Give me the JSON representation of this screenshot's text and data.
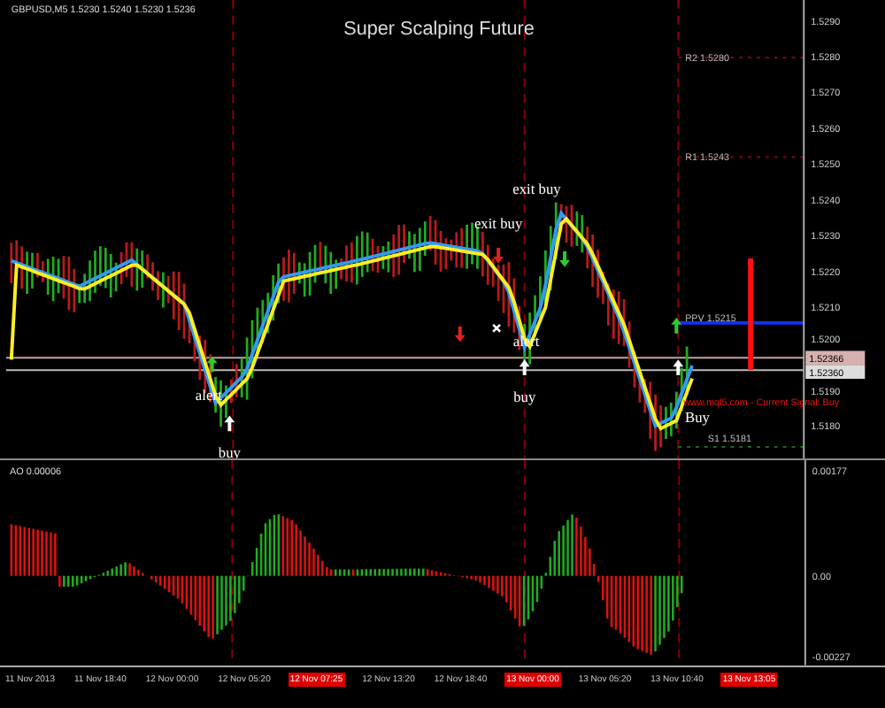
{
  "chart": {
    "symbol_info": "GBPUSD,M5 1.5230 1.5240 1.5230 1.5236",
    "title": "Super Scalping Future",
    "signals": [
      {
        "kind": "label",
        "text": "exit buy"
      },
      {
        "kind": "label",
        "text": "exit buy"
      },
      {
        "kind": "label",
        "text": "alert"
      },
      {
        "kind": "label",
        "text": "alert"
      },
      {
        "kind": "label",
        "text": "buy"
      },
      {
        "kind": "label",
        "text": "Buy"
      },
      {
        "kind": "label",
        "text": "buy"
      }
    ],
    "pivots": [
      {
        "label": "R2 1.5280",
        "kind": "dotted"
      },
      {
        "label": "R1 1.5243",
        "kind": "dotted"
      },
      {
        "label": "PPV 1.5215",
        "kind": "solid"
      },
      {
        "label": "S1 1.5181",
        "kind": "dotted"
      }
    ],
    "current_signal": "www.mql5.com - Current Signal: Buy",
    "price_axis": [
      "1.5290",
      "1.5280",
      "1.5270",
      "1.5260",
      "1.5250",
      "1.5240",
      "1.5230",
      "1.5220",
      "1.5210",
      "1.5200",
      "1.5190",
      "1.5180"
    ],
    "bid_price": "1.52366",
    "ask_price": "1.52360"
  },
  "indicator": {
    "label": "AO 0.00006",
    "axis": [
      "0.00177",
      "0.00",
      "-0.00227"
    ]
  },
  "time_axis": [
    {
      "text": "11 Nov 2013",
      "selected": false
    },
    {
      "text": "11 Nov 18:40",
      "selected": false
    },
    {
      "text": "12 Nov 00:00",
      "selected": false
    },
    {
      "text": "12 Nov 05:20",
      "selected": false
    },
    {
      "text": "12 Nov 07:25",
      "selected": true
    },
    {
      "text": "12 Nov 13:20",
      "selected": false
    },
    {
      "text": "12 Nov 18:40",
      "selected": false
    },
    {
      "text": "13 Nov 00:00",
      "selected": true
    },
    {
      "text": "13 Nov 05:20",
      "selected": false
    },
    {
      "text": "13 Nov 10:40",
      "selected": false
    },
    {
      "text": "13 Nov 13:05",
      "selected": true
    }
  ]
}
